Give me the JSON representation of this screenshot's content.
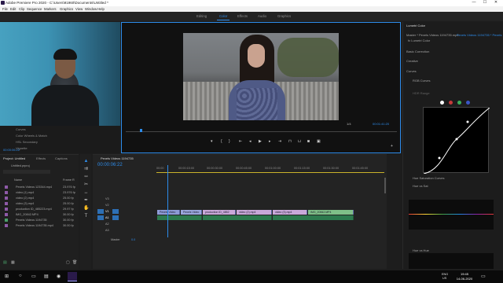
{
  "titlebar": {
    "title": "Adobe Premiere Pro 2020 - C:\\Users\\91960\\Documents\\Untitled *",
    "min": "—",
    "max": "☐",
    "close": "✕"
  },
  "menubar": [
    "File",
    "Edit",
    "Clip",
    "Sequence",
    "Markers",
    "Graphics",
    "View",
    "Window",
    "Help"
  ],
  "workspaces": {
    "items": [
      "Editing",
      "Color",
      "Effects",
      "Audio",
      "Graphics"
    ],
    "active": "Color"
  },
  "left_panel": {
    "items": [
      "Curves",
      "Color Wheels & Match",
      "HSL Secondary",
      "Vignette"
    ],
    "timecode": "00:00:06:22"
  },
  "program_monitor": {
    "fit": "1/4",
    "duration": "00:01:41:20",
    "controls": [
      "marker",
      "in",
      "out",
      "go-to-in",
      "step-back",
      "play",
      "step-forward",
      "go-to-out",
      "insert",
      "overwrite",
      "export-frame",
      "button-editor"
    ]
  },
  "project": {
    "tabs": [
      "Project: Untitled",
      "Effects",
      "Captions"
    ],
    "path": "Untitled.prproj",
    "header_name": "Name",
    "header_frame": "Frame R",
    "items": [
      {
        "name": "Pexels Videos 123344.mp4",
        "rate": "23.976 fp",
        "color": "#8e5aa8"
      },
      {
        "name": "video (1).mp4",
        "rate": "23.976 fp",
        "color": "#8e5aa8"
      },
      {
        "name": "video (2).mp4",
        "rate": "25.00 fp",
        "color": "#8e5aa8"
      },
      {
        "name": "video (3).mp4",
        "rate": "25.00 fp",
        "color": "#8e5aa8"
      },
      {
        "name": "production ID_485223.mp4",
        "rate": "29.97 fp",
        "color": "#8e5aa8"
      },
      {
        "name": "IMG_20842.MP4",
        "rate": "30.00 fp",
        "color": "#8e5aa8"
      },
      {
        "name": "Pexels Videos 1194735",
        "rate": "30.00 fp",
        "color": "#4aa06a"
      },
      {
        "name": "Pexels Videos 1194735.mp4",
        "rate": "30.00 fp",
        "color": "#8e5aa8"
      }
    ]
  },
  "timeline": {
    "tab": "Pexels Videos 1194735",
    "timecode": "00:00:06:22",
    "ruler": [
      "00:00",
      "00:00:15:00",
      "00:00:30:00",
      "00:00:45:00",
      "00:01:00:00",
      "00:01:15:00",
      "00:01:30:00",
      "00:01:45:00"
    ],
    "tracks": [
      "V3",
      "V2",
      "V1",
      "A1",
      "A2",
      "A3",
      "Master"
    ],
    "master_value": "0.0",
    "clips": [
      {
        "label": "Pexels Video",
        "color": "#8e9bd6"
      },
      {
        "label": "Pexels Video",
        "color": "#8e9bd6"
      },
      {
        "label": "production ID_4852",
        "color": "#c9a8d8"
      },
      {
        "label": "video (2).mp4",
        "color": "#c9a8d8"
      },
      {
        "label": "video (3).mp4",
        "color": "#c9a8d8"
      },
      {
        "label": "IMG_20842.MP4",
        "color": "#7fbf88"
      }
    ]
  },
  "lumetri": {
    "tab": "Lumetri Color",
    "master": "Master * Pexels Videos 1194735.mp4",
    "clip": "Pexels Videos 1194735 * Pexels",
    "effect": "fx Lumetri Color",
    "sections": [
      "Basic Correction",
      "Creative",
      "Curves"
    ],
    "rgb_curves": "RGB Curves",
    "hdr_range": "HDR Range",
    "hue_sat": "Hue Saturation Curves",
    "hue_vs_sat": "Hue vs Sat",
    "hue_vs_hue": "Hue vs Hue"
  },
  "taskbar": {
    "time": "19:45",
    "date": "14-06-2020",
    "lang": "ENG",
    "region": "US"
  }
}
